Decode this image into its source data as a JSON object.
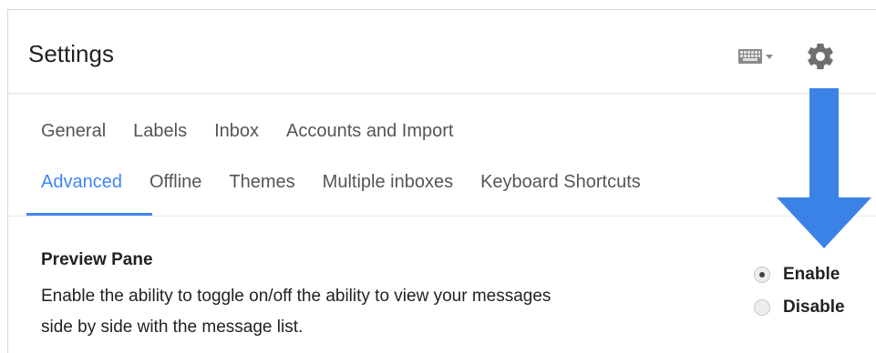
{
  "header": {
    "title": "Settings",
    "keyboard_icon": "keyboard-icon",
    "dropdown_icon": "caret-down-icon",
    "gear_icon": "gear-icon"
  },
  "tabs": {
    "row1": [
      {
        "label": "General",
        "active": false
      },
      {
        "label": "Labels",
        "active": false
      },
      {
        "label": "Inbox",
        "active": false
      },
      {
        "label": "Accounts and Import",
        "active": false
      }
    ],
    "row2": [
      {
        "label": "Advanced",
        "active": true
      },
      {
        "label": "Offline",
        "active": false
      },
      {
        "label": "Themes",
        "active": false
      },
      {
        "label": "Multiple inboxes",
        "active": false
      },
      {
        "label": "Keyboard Shortcuts",
        "active": false
      }
    ]
  },
  "preview_pane": {
    "title": "Preview Pane",
    "description": "Enable the ability to toggle on/off the ability to view your messages side by side with the message list.",
    "options": [
      {
        "label": "Enable",
        "selected": true
      },
      {
        "label": "Disable",
        "selected": false
      }
    ]
  },
  "colors": {
    "accent": "#4285f4",
    "arrow": "#3b82e6",
    "text": "#222222",
    "tab_text": "#555555"
  },
  "annotation": {
    "icon": "arrow-down-icon"
  }
}
